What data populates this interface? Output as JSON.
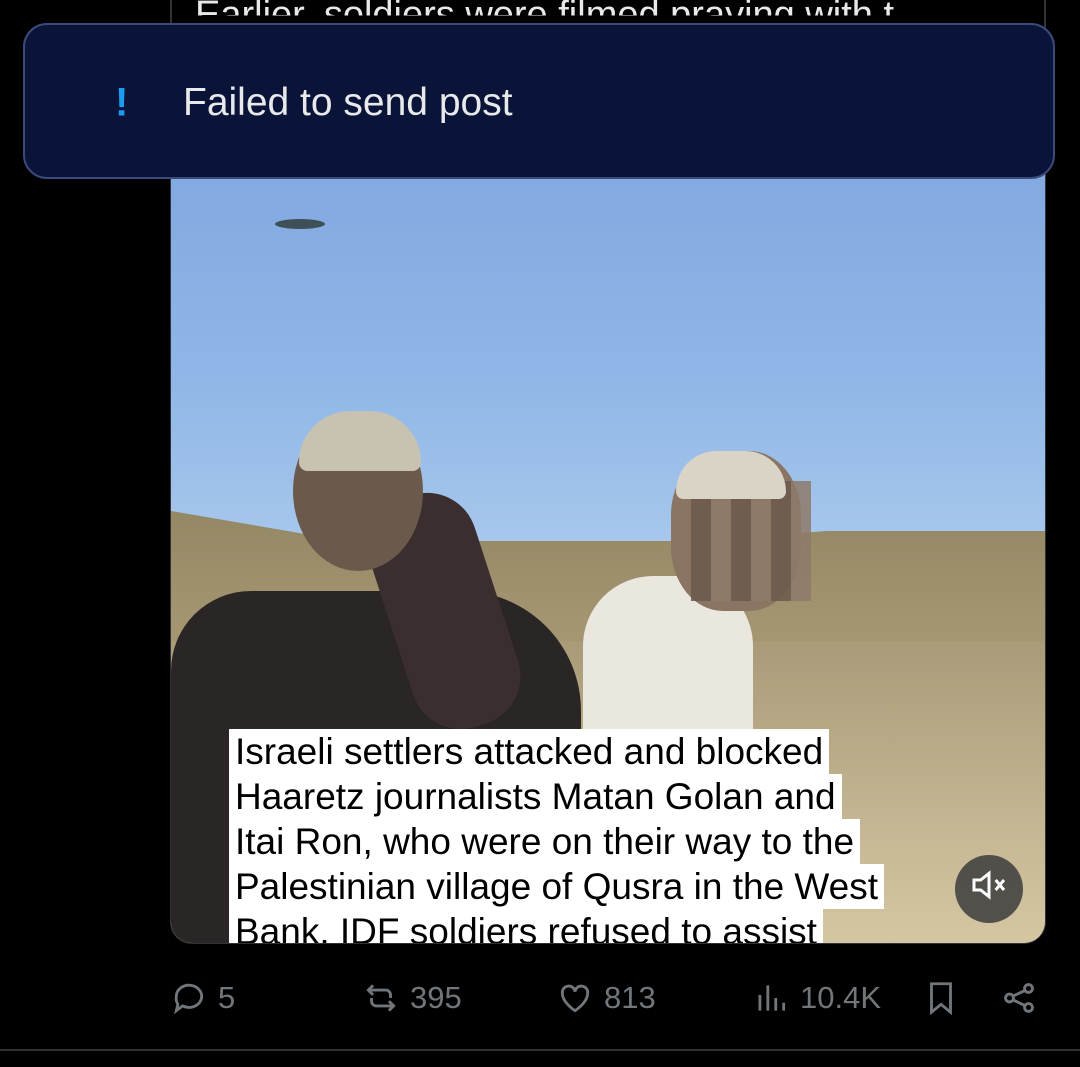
{
  "tweet": {
    "quoted_text": "Earlier, soldiers were filmed praying with t"
  },
  "toast": {
    "icon": "exclamation-icon",
    "message": "Failed to send post",
    "accent_color": "#1d9bf0"
  },
  "media": {
    "caption_lines": [
      "Israeli settlers attacked and blocked",
      "Haaretz journalists Matan Golan and",
      "Itai Ron, who were on their way to the",
      "Palestinian village of Qusra in the West",
      "Bank. IDF soldiers refused to assist"
    ],
    "mute_icon": "speaker-muted-icon"
  },
  "actions": {
    "replies": "5",
    "reposts": "395",
    "likes": "813",
    "views": "10.4K",
    "bookmark_icon": "bookmark-icon",
    "share_icon": "share-icon"
  }
}
